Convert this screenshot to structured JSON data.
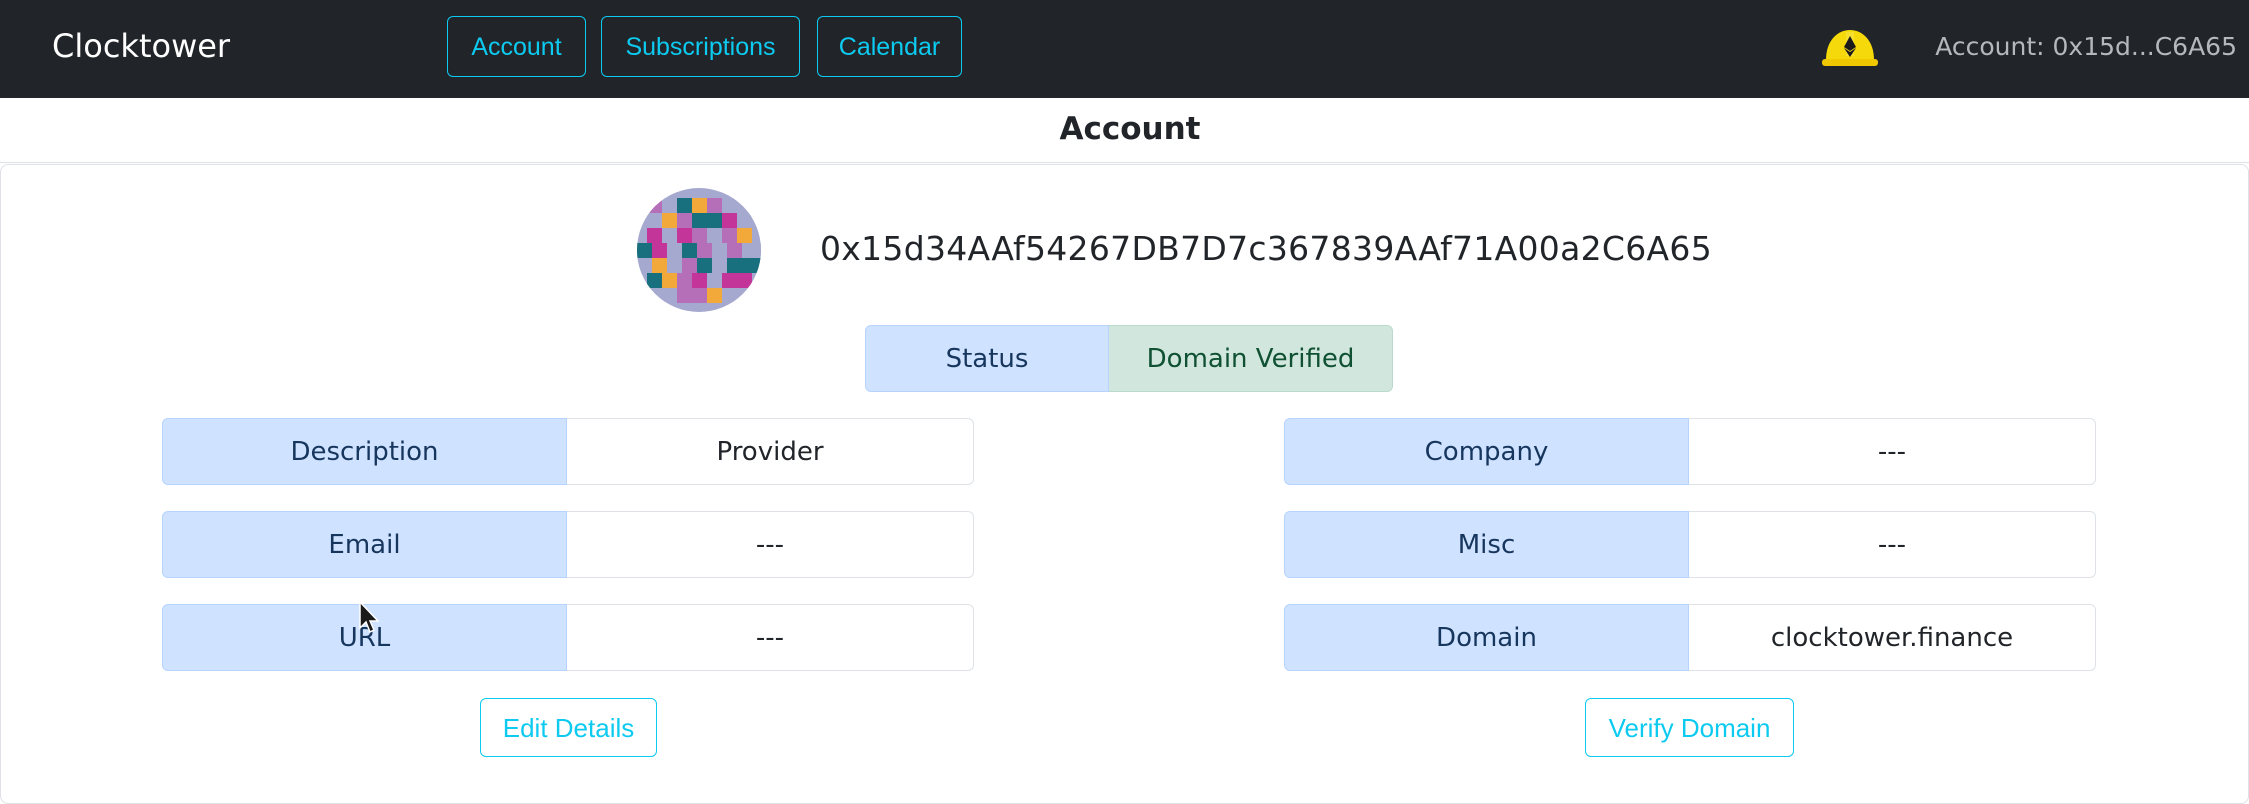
{
  "navbar": {
    "brand": "Clocktower",
    "buttons": [
      "Account",
      "Subscriptions",
      "Calendar"
    ],
    "account_text": "Account: 0x15d...C6A65",
    "network_icon": "ethereum-hardhat-icon"
  },
  "page": {
    "title": "Account"
  },
  "profile": {
    "address": "0x15d34AAf54267DB7D7c367839AAf71A00a2C6A65",
    "avatar_icon": "identicon-avatar",
    "status_label": "Status",
    "status_value": "Domain Verified"
  },
  "details_left": [
    {
      "label": "Description",
      "value": "Provider"
    },
    {
      "label": "Email",
      "value": "---"
    },
    {
      "label": "URL",
      "value": "---"
    }
  ],
  "details_right": [
    {
      "label": "Company",
      "value": "---"
    },
    {
      "label": "Misc",
      "value": "---"
    },
    {
      "label": "Domain",
      "value": "clocktower.finance"
    }
  ],
  "actions": {
    "edit_label": "Edit Details",
    "verify_label": "Verify Domain"
  },
  "colors": {
    "navbar_bg": "#212529",
    "accent": "#0dcaf0",
    "label_bg": "#cfe2ff",
    "verified_bg": "#d1e7dd"
  }
}
